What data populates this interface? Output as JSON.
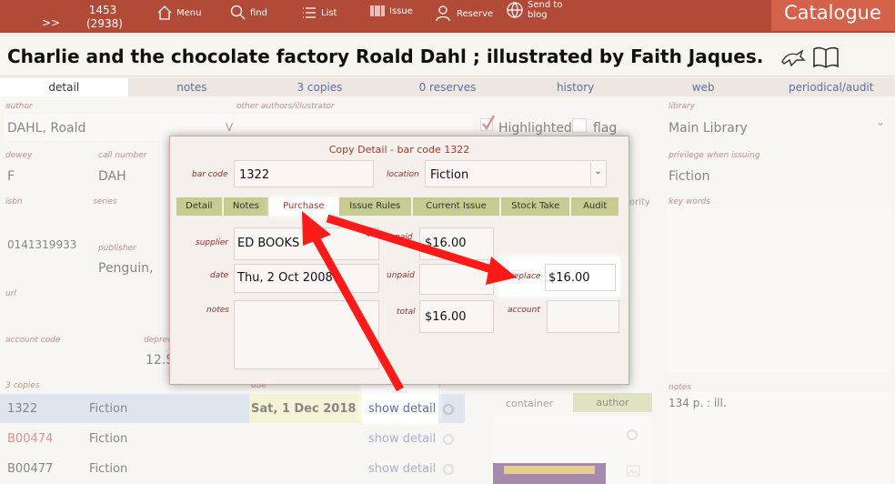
{
  "topbar": {
    "expand": ">>",
    "count_main": "1453",
    "count_sub": "(2938)",
    "menu": "Menu",
    "find": "find",
    "list": "List",
    "issue": "Issue",
    "reserve": "Reserve",
    "send_to_blog": "Send to blog",
    "catalogue": "Catalogue"
  },
  "record_title": "Charlie and the chocolate factory Roald Dahl ; illustrated by Faith Jaques.",
  "tabs": [
    "detail",
    "notes",
    "3 copies",
    "0 reserves",
    "history",
    "web",
    "periodical/audit"
  ],
  "fields": {
    "author_label": "author",
    "author": "DAHL, Roald",
    "author_marker": "V",
    "other_authors_label": "other authors/illustrator",
    "highlighted": "Highlighted",
    "flag": "flag",
    "library_label": "library",
    "library": "Main Library",
    "dewey_label": "dewey",
    "dewey": "F",
    "call_number_label": "call number",
    "call_number": "DAH",
    "privilege_label": "privilege when issuing",
    "privilege": "Fiction",
    "isbn_label": "isbn",
    "isbn": "0141319933",
    "series_label": "series",
    "key_words_label": "key words",
    "authority_partial": "ority",
    "publisher_label": "publisher",
    "publisher": "Penguin,",
    "url_label": "url",
    "account_code_label": "account code",
    "deprec_label": "deprec",
    "deprec_value": "12.5",
    "copies_label": "3 copies",
    "due_label": "due",
    "copies_partial_label": "copies",
    "notes_label": "notes",
    "notes_value": "134 p. : ill.",
    "container": "container",
    "author_button": "author"
  },
  "copies": [
    {
      "barcode": "1322",
      "location": "Fiction",
      "due": "Sat, 1 Dec 2018",
      "action": "show detail",
      "flagged": false
    },
    {
      "barcode": "B00474",
      "location": "Fiction",
      "due": "",
      "action": "show detail",
      "flagged": true
    },
    {
      "barcode": "B00477",
      "location": "Fiction",
      "due": "",
      "action": "show detail",
      "flagged": false
    }
  ],
  "modal": {
    "title": "Copy Detail - bar code 1322",
    "bar_code_label": "bar code",
    "bar_code": "1322",
    "location_label": "location",
    "location": "Fiction",
    "tabs": [
      "Detail",
      "Notes",
      "Purchase",
      "Issue Rules",
      "Current Issue",
      "Stock Take",
      "Audit"
    ],
    "supplier_label": "supplier",
    "supplier": "ED BOOKS",
    "paid_label": "paid",
    "paid": "$16.00",
    "date_label": "date",
    "date": "Thu, 2 Oct 2008",
    "unpaid_label": "unpaid",
    "replace_label": "replace",
    "replace": "$16.00",
    "notes_label": "notes",
    "total_label": "total",
    "total": "$16.00",
    "account_label": "account"
  },
  "colors": {
    "topbar": "#b14a36",
    "accent": "#d4614a",
    "tab_green": "#c6cb8f",
    "label_red": "#8e2f27",
    "link_blue": "#5b6fa8",
    "arrow_red": "#ff1a1a"
  }
}
